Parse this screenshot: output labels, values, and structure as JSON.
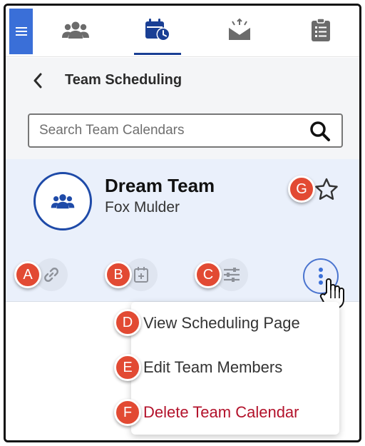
{
  "nav": {
    "tabs": [
      {
        "icon": "team-icon",
        "active": false
      },
      {
        "icon": "calendar-clock-icon",
        "active": true
      },
      {
        "icon": "mail-inbox-icon",
        "active": false
      },
      {
        "icon": "clipboard-list-icon",
        "active": false
      }
    ],
    "active_color": "#1a3f94",
    "menu_color": "#3a6fd8"
  },
  "header": {
    "title": "Team Scheduling"
  },
  "search": {
    "placeholder": "Search Team Calendars",
    "value": ""
  },
  "team": {
    "name": "Dream Team",
    "owner": "Fox Mulder",
    "favorite": false
  },
  "actions": [
    {
      "icon": "link-icon",
      "callout": "A"
    },
    {
      "icon": "calendar-add-icon",
      "callout": "B"
    },
    {
      "icon": "sliders-icon",
      "callout": "C"
    },
    {
      "icon": "more-vertical-icon",
      "callout": ""
    }
  ],
  "star_callout": "G",
  "menu": {
    "items": [
      {
        "label": "View Scheduling Page",
        "callout": "D",
        "danger": false
      },
      {
        "label": "Edit Team Members",
        "callout": "E",
        "danger": false
      },
      {
        "label": "Delete Team Calendar",
        "callout": "F",
        "danger": true
      }
    ]
  },
  "colors": {
    "callout": "#e24a33",
    "danger": "#b3122b",
    "card_bg": "#eaf0fb",
    "header_bg": "#f4f5f7"
  }
}
